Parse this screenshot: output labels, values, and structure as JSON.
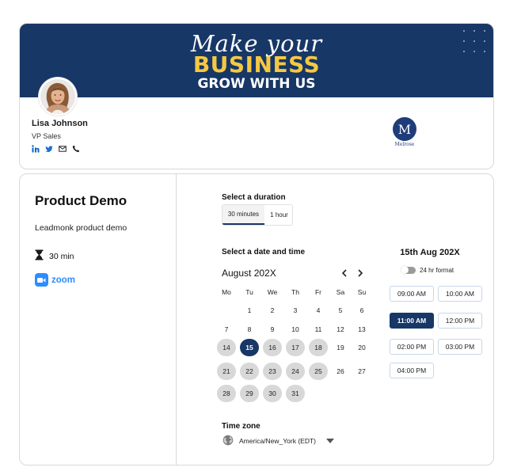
{
  "profile": {
    "banner_script": "Make your",
    "banner_big": "BUSINESS",
    "banner_small": "GROW WITH US",
    "name": "Lisa Johnson",
    "role": "VP Sales",
    "social_icons": [
      "linkedin-icon",
      "twitter-icon",
      "mail-icon",
      "phone-icon"
    ],
    "company_logo_letter": "M",
    "company_name": "Melrose"
  },
  "event": {
    "title": "Product Demo",
    "description": "Leadmonk product demo",
    "duration": "30 min",
    "platform": "zoom"
  },
  "duration_section": {
    "label": "Select a duration",
    "options": [
      "30 minutes",
      "1 hour"
    ],
    "selected": "30 minutes"
  },
  "calendar": {
    "label": "Select a date and time",
    "month": "August 202X",
    "weekdays": [
      "Mo",
      "Tu",
      "We",
      "Th",
      "Fr",
      "Sa",
      "Su"
    ],
    "weeks": [
      [
        "",
        "1",
        "2",
        "3",
        "4",
        "5",
        "6"
      ],
      [
        "7",
        "8",
        "9",
        "10",
        "11",
        "12",
        "13"
      ],
      [
        "14",
        "15",
        "16",
        "17",
        "18",
        "19",
        "20"
      ],
      [
        "21",
        "22",
        "23",
        "24",
        "25",
        "26",
        "27"
      ],
      [
        "28",
        "29",
        "30",
        "31",
        "",
        "",
        ""
      ]
    ],
    "available_days": [
      "14",
      "16",
      "17",
      "18",
      "21",
      "22",
      "23",
      "24",
      "25",
      "28",
      "29",
      "30",
      "31"
    ],
    "selected_day": "15"
  },
  "times": {
    "heading": "15th Aug 202X",
    "format_label": "24 hr format",
    "slots": [
      "09:00 AM",
      "10:00 AM",
      "11:00 AM",
      "12:00 PM",
      "02:00 PM",
      "03:00 PM",
      "04:00 PM"
    ],
    "selected": "11:00 AM"
  },
  "timezone": {
    "label": "Time zone",
    "value": "America/New_York (EDT)"
  },
  "colors": {
    "brand_navy": "#173766",
    "accent_yellow": "#f5c842",
    "zoom_blue": "#2d8cff",
    "available_grey": "#d8d8d8"
  }
}
